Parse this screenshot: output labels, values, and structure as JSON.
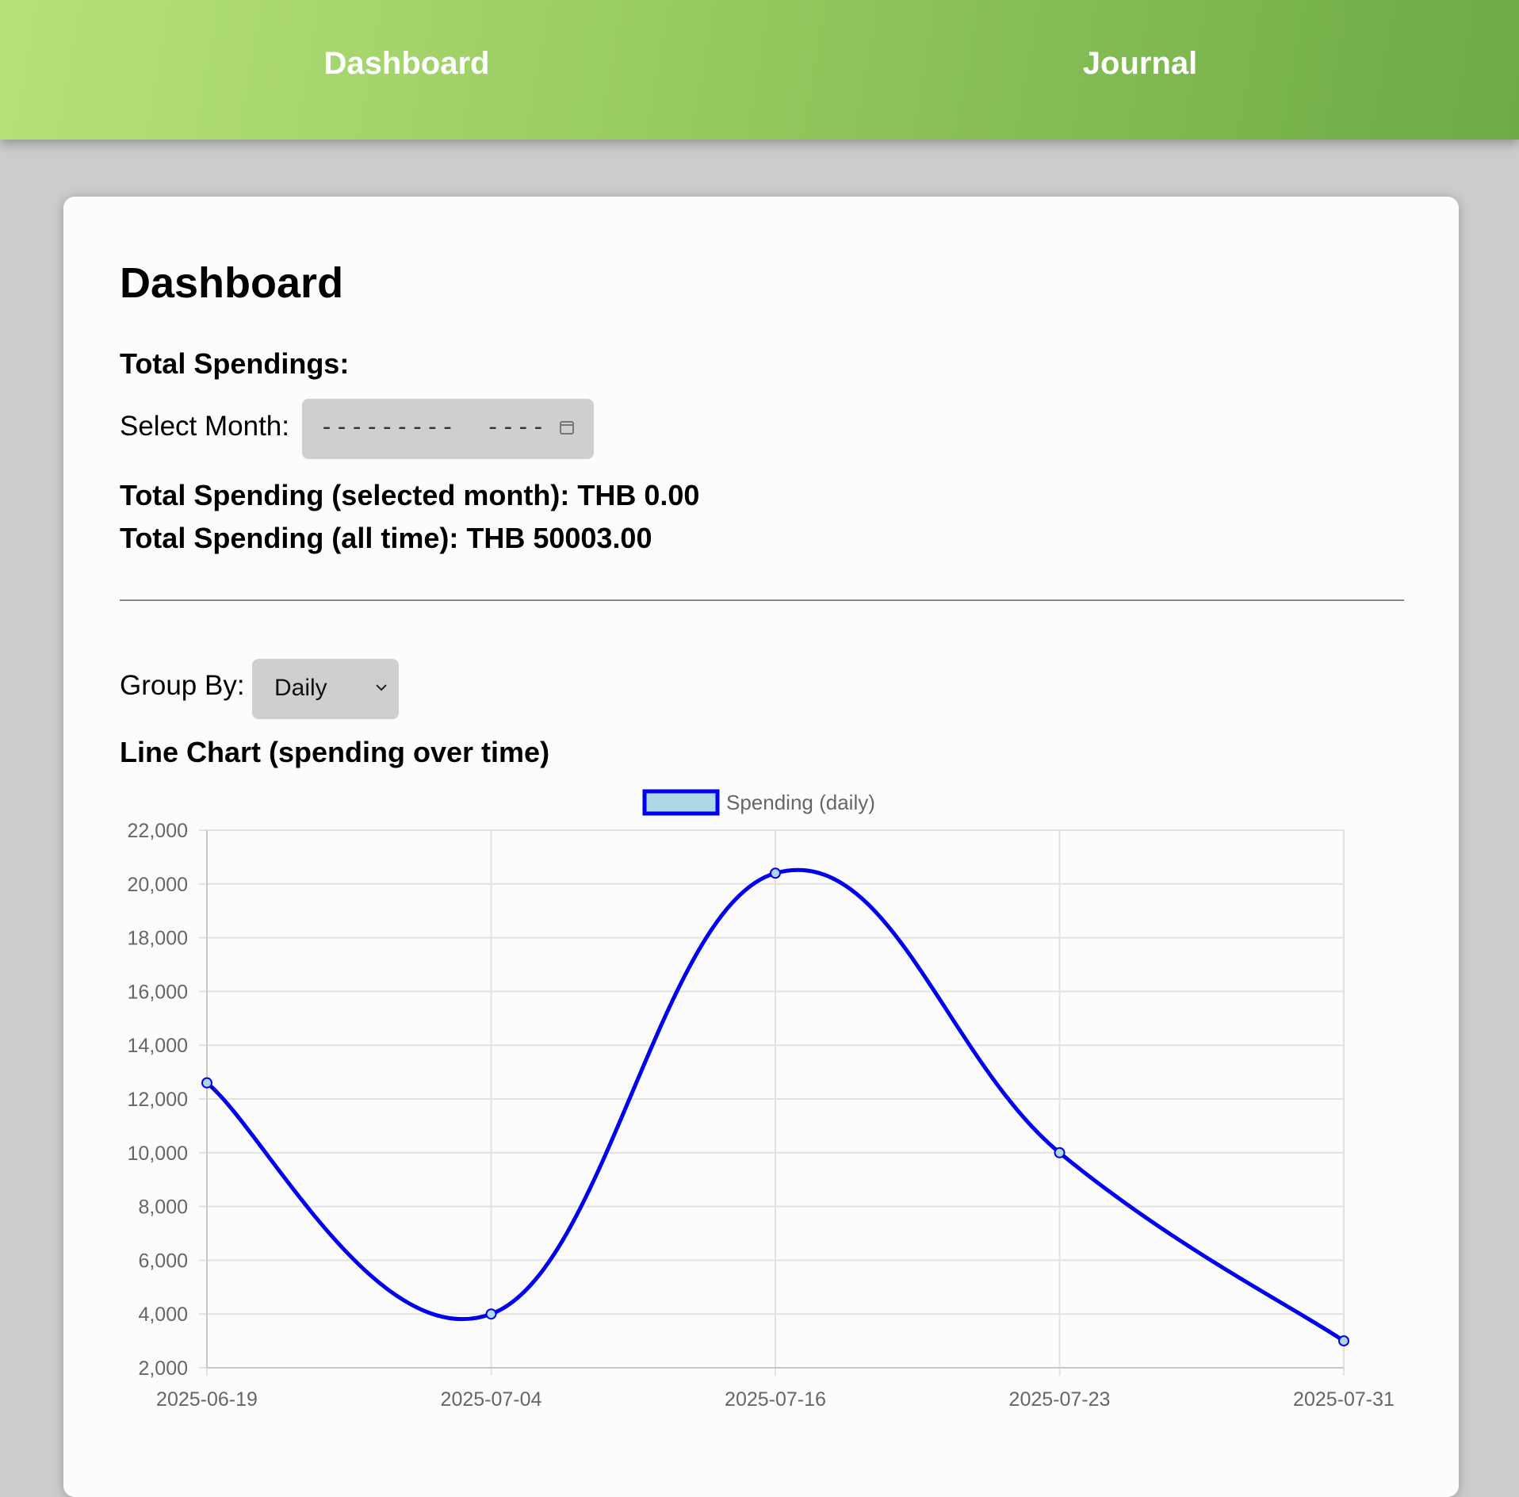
{
  "nav": {
    "dashboard_label": "Dashboard",
    "journal_label": "Journal"
  },
  "page": {
    "title": "Dashboard",
    "section_heading": "Total Spendings:",
    "select_month_label": "Select Month:",
    "month_input_placeholder": "---------  ----",
    "total_month_text": "Total Spending (selected month): THB 0.00",
    "total_all_text": "Total Spending (all time): THB 50003.00",
    "group_by_label": "Group By:",
    "group_by_value": "Daily",
    "chart_heading": "Line Chart (spending over time)"
  },
  "colors": {
    "nav_gradient_start": "#b7e17a",
    "nav_gradient_end": "#6dab45",
    "line": "#0000ee",
    "legend_fill": "#add8e6"
  },
  "chart_data": {
    "type": "line",
    "title": "",
    "xlabel": "",
    "ylabel": "",
    "x": [
      "2025-06-19",
      "2025-07-04",
      "2025-07-16",
      "2025-07-23",
      "2025-07-31"
    ],
    "series": [
      {
        "name": "Spending (daily)",
        "values": [
          12600,
          4000,
          20400,
          10000,
          3000
        ]
      }
    ],
    "ylim": [
      2000,
      22000
    ],
    "yticks": [
      2000,
      4000,
      6000,
      8000,
      10000,
      12000,
      14000,
      16000,
      18000,
      20000,
      22000
    ],
    "ytick_labels": [
      "2,000",
      "4,000",
      "6,000",
      "8,000",
      "10,000",
      "12,000",
      "14,000",
      "16,000",
      "18,000",
      "20,000",
      "22,000"
    ],
    "grid": true,
    "legend": "top-center",
    "smooth": true
  }
}
